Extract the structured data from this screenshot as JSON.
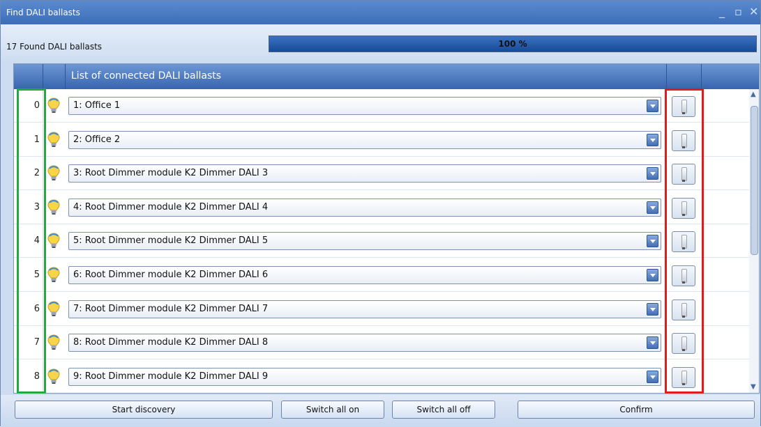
{
  "window": {
    "title": "Find DALI ballasts"
  },
  "status": {
    "found_text": "17 Found DALI ballasts",
    "progress_text": "100 %",
    "progress_value": 100
  },
  "grid": {
    "header": "List of connected DALI ballasts",
    "rows": [
      {
        "index": "0",
        "value": "1: Office 1"
      },
      {
        "index": "1",
        "value": "2: Office 2"
      },
      {
        "index": "2",
        "value": "3: Root Dimmer module K2 Dimmer DALI 3"
      },
      {
        "index": "3",
        "value": "4: Root Dimmer module K2 Dimmer DALI 4"
      },
      {
        "index": "4",
        "value": "5: Root Dimmer module K2 Dimmer DALI 5"
      },
      {
        "index": "5",
        "value": "6: Root Dimmer module K2 Dimmer DALI 6"
      },
      {
        "index": "6",
        "value": "7: Root Dimmer module K2 Dimmer DALI 7"
      },
      {
        "index": "7",
        "value": "8: Root Dimmer module K2 Dimmer DALI 8"
      },
      {
        "index": "8",
        "value": "9: Root Dimmer module K2 Dimmer DALI 9"
      }
    ]
  },
  "buttons": {
    "start_discovery": "Start discovery",
    "switch_all_on": "Switch all on",
    "switch_all_off": "Switch all off",
    "confirm": "Confirm"
  },
  "colors": {
    "highlight_index": "#23a843",
    "highlight_lamp": "#e01b1b",
    "accent": "#3c6db8"
  },
  "icons": {
    "row_icon": "bulb-icon",
    "lamp_button_icon": "fluorescent-lamp-icon"
  }
}
